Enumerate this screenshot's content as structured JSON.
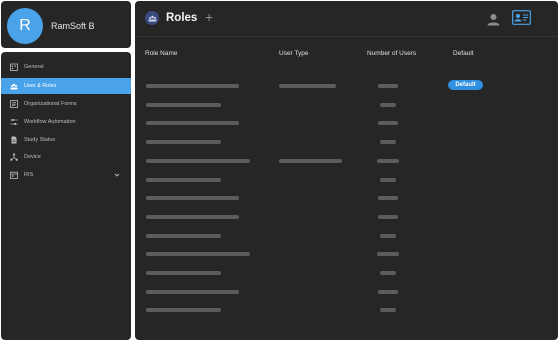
{
  "org": {
    "avatar_letter": "R",
    "name": "RamSoft B"
  },
  "sidebar": {
    "items": [
      {
        "label": "General",
        "icon": "building-icon",
        "active": false
      },
      {
        "label": "User & Roles",
        "icon": "roles-icon",
        "active": true
      },
      {
        "label": "Organizational Forms",
        "icon": "form-icon",
        "active": false
      },
      {
        "label": "Workflow Automation",
        "icon": "sliders-icon",
        "active": false
      },
      {
        "label": "Study Status",
        "icon": "document-icon",
        "active": false
      },
      {
        "label": "Device",
        "icon": "device-hub-icon",
        "active": false
      },
      {
        "label": "RIS",
        "icon": "calendar-icon",
        "active": false,
        "has_chevron": true
      }
    ]
  },
  "header": {
    "title": "Roles",
    "add_label": "+"
  },
  "table": {
    "columns": [
      "Role Name",
      "User Type",
      "Number of Users",
      "Default"
    ],
    "rows": [
      {
        "has_user_type": true,
        "default": "Default"
      },
      {
        "has_user_type": false,
        "default": ""
      },
      {
        "has_user_type": false,
        "default": ""
      },
      {
        "has_user_type": false,
        "default": ""
      },
      {
        "has_user_type": true,
        "default": ""
      },
      {
        "has_user_type": false,
        "default": ""
      },
      {
        "has_user_type": false,
        "default": ""
      },
      {
        "has_user_type": false,
        "default": ""
      },
      {
        "has_user_type": false,
        "default": ""
      },
      {
        "has_user_type": false,
        "default": ""
      },
      {
        "has_user_type": false,
        "default": ""
      },
      {
        "has_user_type": false,
        "default": ""
      },
      {
        "has_user_type": false,
        "default": ""
      }
    ]
  },
  "colors": {
    "accent": "#4aa3e8",
    "panel": "#262626",
    "badge": "#2f8fe0",
    "skeleton": "#5c5c5c"
  }
}
